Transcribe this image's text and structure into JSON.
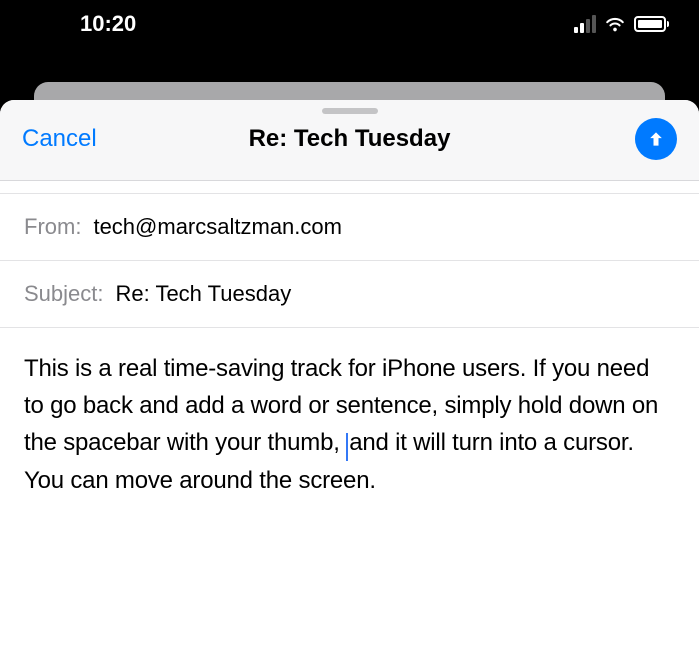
{
  "statusBar": {
    "time": "10:20"
  },
  "compose": {
    "cancelLabel": "Cancel",
    "title": "Re: Tech Tuesday",
    "fromLabel": "From:",
    "fromValue": "tech@marcsaltzman.com",
    "subjectLabel": "Subject:",
    "subjectValue": "Re: Tech Tuesday",
    "bodyPart1": "This is a real time-saving track for iPhone users. If you need to go back and add a word or sentence, simply hold down on the spacebar with your thumb, ",
    "bodyPart2": "and it will turn into a cursor. You can move around the screen."
  }
}
